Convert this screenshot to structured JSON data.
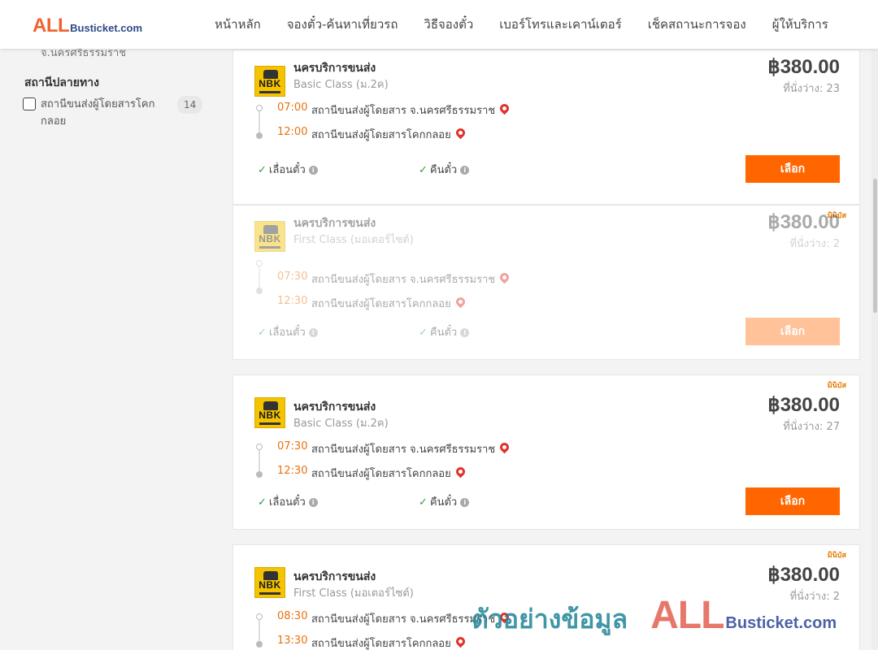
{
  "header": {
    "logo_main": "ALL",
    "logo_rest": "Busticket.com",
    "nav": [
      "หน้าหลัก",
      "จองตั๋ว-ค้นหาเที่ยวรถ",
      "วิธีจองตั๋ว",
      "เบอร์โทรและเคาน์เตอร์",
      "เช็คสถานะการจอง",
      "ผู้ให้บริการ"
    ]
  },
  "sidebar": {
    "cut_text": "จ.นครศรีธรรมราช",
    "destination_heading": "สถานีปลายทาง",
    "destination_filter": {
      "label": "สถานีขนส่งผู้โดยสารโคกกลอย",
      "count": "14"
    }
  },
  "trips": [
    {
      "badge": "",
      "operator": "นครบริการขนส่ง",
      "logo_text": "NBK",
      "class": "Basic Class (ม.2ค)",
      "price": "฿380.00",
      "seats": "ที่นั่งว่าง: 23",
      "depart_time": "07:00",
      "depart_station": "สถานีขนส่งผู้โดยสาร จ.นครศรีธรรมราช",
      "arrive_time": "12:00",
      "arrive_station": "สถานีขนส่งผู้โดยสารโคกกลอย",
      "feature_change": "เลื่อนตั๋ว",
      "feature_refund": "คืนตั๋ว",
      "button": "เลือก"
    },
    {
      "badge": "มินิบัส",
      "operator": "นครบริการขนส่ง",
      "logo_text": "NBK",
      "class": "First Class (มอเตอร์ไซต์)",
      "price": "฿380.00",
      "seats": "ที่นั่งว่าง: 2",
      "depart_time": "07:30",
      "depart_station": "สถานีขนส่งผู้โดยสาร จ.นครศรีธรรมราช",
      "arrive_time": "12:30",
      "arrive_station": "สถานีขนส่งผู้โดยสารโคกกลอย",
      "feature_change": "เลื่อนตั๋ว",
      "feature_refund": "คืนตั๋ว",
      "button": "เลือก"
    },
    {
      "badge": "มินิบัส",
      "operator": "นครบริการขนส่ง",
      "logo_text": "NBK",
      "class": "Basic Class (ม.2ค)",
      "price": "฿380.00",
      "seats": "ที่นั่งว่าง: 27",
      "depart_time": "07:30",
      "depart_station": "สถานีขนส่งผู้โดยสาร จ.นครศรีธรรมราช",
      "arrive_time": "12:30",
      "arrive_station": "สถานีขนส่งผู้โดยสารโคกกลอย",
      "feature_change": "เลื่อนตั๋ว",
      "feature_refund": "คืนตั๋ว",
      "button": "เลือก"
    },
    {
      "badge": "มินิบัส",
      "operator": "นครบริการขนส่ง",
      "logo_text": "NBK",
      "class": "First Class (มอเตอร์ไซต์)",
      "price": "฿380.00",
      "seats": "ที่นั่งว่าง: 2",
      "depart_time": "08:30",
      "depart_station": "สถานีขนส่งผู้โดยสาร จ.นครศรีธรรมราช",
      "arrive_time": "13:30",
      "arrive_station": "สถานีขนส่งผู้โดยสารโคกกลอย",
      "feature_change": "",
      "feature_refund": "",
      "button": ""
    }
  ],
  "watermark": {
    "text": "ตัวอย่างข้อมูล",
    "brand_main": "ALL",
    "brand_rest": "Busticket.com"
  },
  "colors": {
    "accent": "#ff6600",
    "time": "#e8720c",
    "pin": "#e0332b",
    "check": "#2e9e3e"
  }
}
